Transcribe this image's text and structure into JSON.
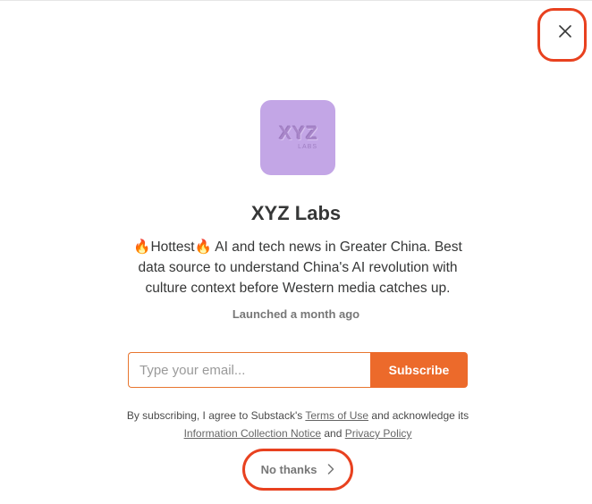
{
  "close": {
    "icon": "close-icon"
  },
  "logo": {
    "main": "XYZ",
    "sub": "LABS",
    "color": "#c3a6e6"
  },
  "publication": {
    "name": "XYZ Labs",
    "description": "🔥Hottest🔥 AI and tech news in Greater China. Best data source to understand China's AI revolution with culture context before Western media catches up.",
    "launched": "Launched a month ago"
  },
  "form": {
    "email_placeholder": "Type your email...",
    "subscribe_label": "Subscribe",
    "accent": "#ec6a2b"
  },
  "legal": {
    "prefix": "By subscribing, I agree to Substack's",
    "terms_link": "Terms of Use",
    "mid": "and acknowledge its",
    "info_link": "Information Collection Notice",
    "and": "and",
    "privacy_link": "Privacy Policy"
  },
  "no_thanks": {
    "label": "No thanks",
    "icon": "chevron-right-icon"
  },
  "highlight_color": "#e8411f"
}
